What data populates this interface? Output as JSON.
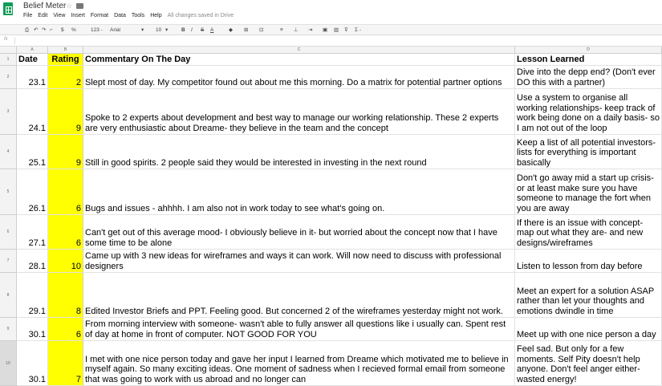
{
  "app": {
    "title": "Belief Meter",
    "star": "☆",
    "folder_icon": "folder-icon"
  },
  "menu": {
    "items": [
      "File",
      "Edit",
      "View",
      "Insert",
      "Format",
      "Data",
      "Tools",
      "Help"
    ],
    "status": "All changes saved in Drive"
  },
  "toolbar": {
    "number_format": "123 -",
    "font": "Arial",
    "font_size": "10",
    "bold": "B",
    "italic": "I",
    "strike": "S",
    "underline_color": "A",
    "sigma": "Σ -",
    "percent": "%",
    "dollar": "$"
  },
  "formula_bar": {
    "fx_label": "fx",
    "value": ""
  },
  "grid": {
    "column_letters": [
      "A",
      "B",
      "C",
      "D"
    ],
    "header_row": {
      "row_number": "1",
      "date": "Date",
      "rating": "Rating",
      "commentary": "Commentary On The Day",
      "lesson": "Lesson Learned"
    },
    "rows": [
      {
        "row_number": "2",
        "date": "23.1",
        "rating": "2",
        "commentary": "Slept most of day. My competitor found out about me this morning. Do a matrix for potential partner options",
        "lesson": "Dive into the depp end? (Don't ever DO this with a partner)"
      },
      {
        "row_number": "3",
        "date": "24.1",
        "rating": "9",
        "commentary": "Spoke to 2 experts about development and best way to manage our working relationship. These 2 experts are very enthusiastic about Dreame- they believe in the team and the concept",
        "lesson": "Use a system to organise all working relationships- keep track of work being done on a daily basis- so I am not out of the loop"
      },
      {
        "row_number": "4",
        "date": "25.1",
        "rating": "9",
        "commentary": "Still in good spirits. 2 people said they would be interested in investing in the next round",
        "lesson": "Keep a list of all potential investors- lists for everything is important basically"
      },
      {
        "row_number": "5",
        "date": "26.1",
        "rating": "6",
        "commentary": "Bugs and issues - ahhhh. I am also not in work today to see what's going on.",
        "lesson": "Don't go away mid a start up crisis- or at least make sure you have someone to manage the fort when you are away"
      },
      {
        "row_number": "6",
        "date": "27.1",
        "rating": "6",
        "commentary": "Can't get out of this average mood- I obviously believe in it- but worried about the concept now that I have some time to be alone",
        "lesson": "If there is an issue with concept- map out what they are- and new designs/wireframes"
      },
      {
        "row_number": "7",
        "date": "28.1",
        "rating": "10",
        "commentary": "Came up with 3 new ideas for wireframes and ways it can work. Will now need to discuss with professional designers",
        "lesson": "Listen to lesson from day before"
      },
      {
        "row_number": "8",
        "date": "29.1",
        "rating": "8",
        "commentary": "Edited Investor Briefs and PPT. Feeling good. But concerned 2 of the wireframes yesterday might not work.",
        "lesson": "Meet an expert for a solution ASAP rather than let your thoughts and emotions dwindle in time"
      },
      {
        "row_number": "9",
        "date": "30.1",
        "rating": "6",
        "commentary": "From morning interview with someone- wasn't able to fully answer all questions like i usually can. Spent rest of day at home in front of computer. NOT GOOD FOR YOU",
        "lesson": "Meet up with one nice person a day"
      },
      {
        "row_number": "10",
        "date": "30.1",
        "rating": "7",
        "commentary": "I met with one nice person today and gave her input I learned from Dreame which motivated me to believe in myself again. So many exciting ideas. One moment of sadness when I recieved formal email from someone that was going to work with us abroad and no longer can",
        "lesson": "Feel sad. But only for a few moments. Self Pity doesn't help anyone. Don't feel anger either- wasted energy!"
      }
    ]
  },
  "colors": {
    "highlight": "#ffff00",
    "logo": "#0f9d58"
  }
}
